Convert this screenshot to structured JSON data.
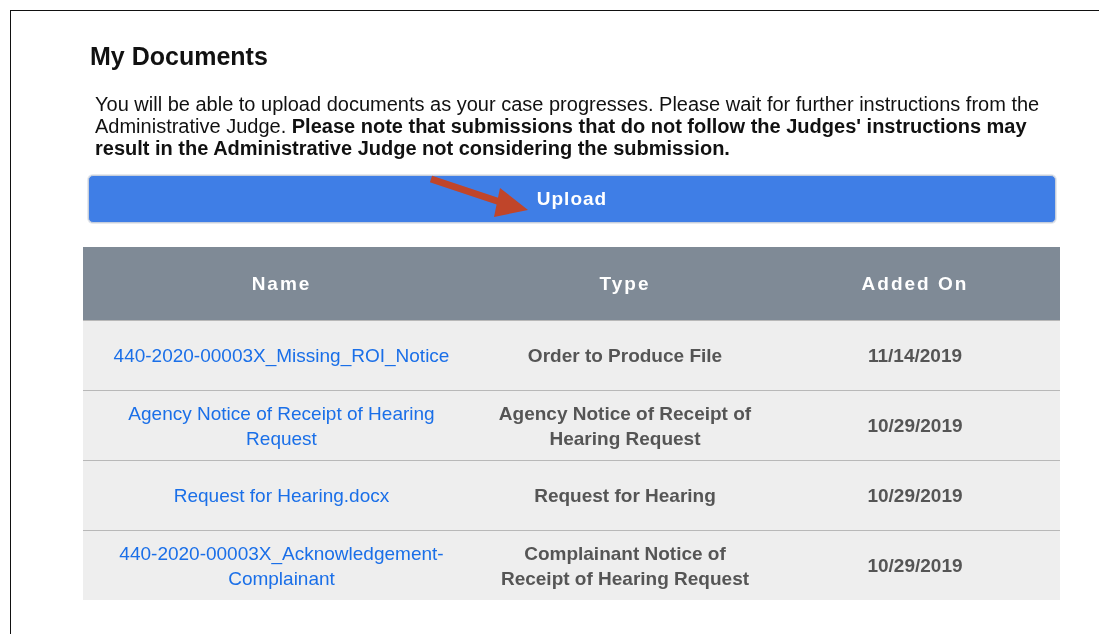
{
  "title": "My Documents",
  "notice": "You will be able to upload documents as your case progresses. Please wait for further instructions from the Administrative Judge. **Please note that submissions that do not follow the Judges' instructions may result in the Administrative Judge not considering the submission.**",
  "upload_button": "Upload",
  "table": {
    "columns": [
      "Name",
      "Type",
      "Added On"
    ],
    "rows": [
      {
        "name": "440-2020-00003X_Missing_ROI_Notice",
        "type": "Order to Produce File",
        "added_on": "11/14/2019"
      },
      {
        "name": "Agency Notice of Receipt of Hearing Request",
        "type": "Agency Notice of Receipt of Hearing Request",
        "added_on": "10/29/2019"
      },
      {
        "name": "Request for Hearing.docx",
        "type": "Request for Hearing",
        "added_on": "10/29/2019"
      },
      {
        "name": "440-2020-00003X_Acknowledgement-Complainant",
        "type": "Complainant Notice of Receipt of Hearing Request",
        "added_on": "10/29/2019"
      }
    ]
  }
}
